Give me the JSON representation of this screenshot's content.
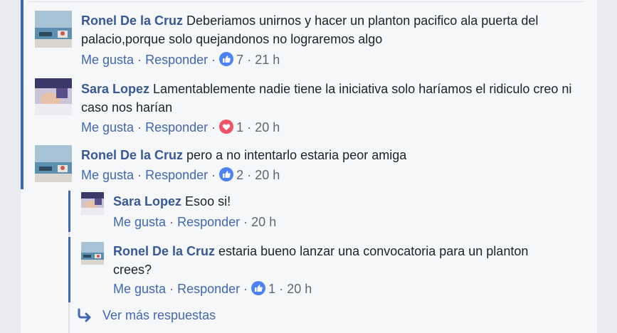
{
  "comments": [
    {
      "author": "Ronel De la Cruz",
      "text": "Deberiamos unirnos y hacer un planton pacifico ala puerta del palacio,porque solo quejandonos no lograremos algo",
      "like_label": "Me gusta",
      "reply_label": "Responder",
      "reaction_icon": "like-icon",
      "reaction_color": "#4c82f6",
      "reaction_count": "7",
      "time": "21 h"
    },
    {
      "author": "Sara Lopez",
      "text": "Lamentablemente nadie tiene la iniciativa solo haríamos el ridiculo creo ni caso nos harían",
      "like_label": "Me gusta",
      "reply_label": "Responder",
      "reaction_icon": "love-icon",
      "reaction_color": "#f25268",
      "reaction_count": "1",
      "time": "20 h"
    },
    {
      "author": "Ronel De la Cruz",
      "text": "pero a no intentarlo estaria peor amiga",
      "like_label": "Me gusta",
      "reply_label": "Responder",
      "reaction_icon": "like-icon",
      "reaction_color": "#4c82f6",
      "reaction_count": "2",
      "time": "20 h"
    }
  ],
  "replies": [
    {
      "author": "Sara Lopez",
      "text": "Esoo si!",
      "like_label": "Me gusta",
      "reply_label": "Responder",
      "time": "20 h"
    },
    {
      "author": "Ronel De la Cruz",
      "text": "estaria bueno lanzar una convocatoria para un planton crees?",
      "like_label": "Me gusta",
      "reply_label": "Responder",
      "reaction_icon": "like-icon",
      "reaction_color": "#4c82f6",
      "reaction_count": "1",
      "time": "20 h"
    }
  ],
  "more_replies": {
    "icon": "reply-arrow-icon",
    "label": "Ver más respuestas"
  },
  "separator": "·",
  "colors": {
    "link": "#4267b2",
    "author": "#385898",
    "thread_bar": "#4267b2",
    "muted": "#606770"
  }
}
